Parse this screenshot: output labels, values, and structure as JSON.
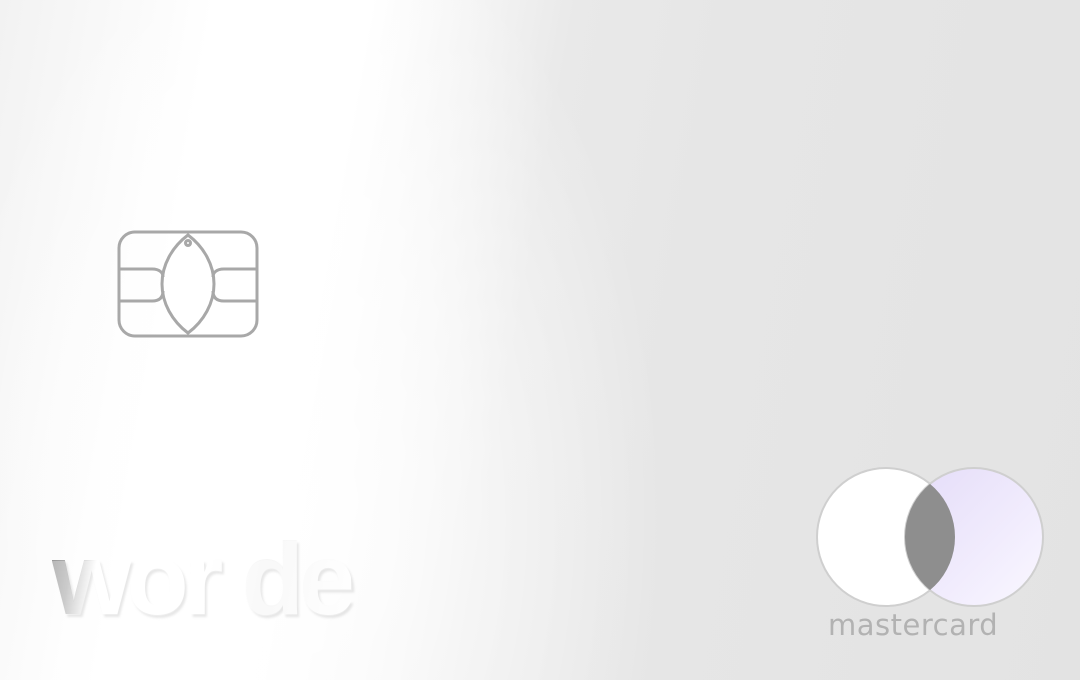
{
  "card": {
    "brand_text": "wor     de",
    "network_text": "mastercard"
  },
  "icons": {
    "chip": "emv-chip-icon",
    "network_logo": "mastercard-circles-icon"
  },
  "colors": {
    "card_base": "#e6e6e6",
    "highlight": "#ffffff",
    "chip_outline": "#a8a8a8",
    "mc_overlap": "#8e8e8e",
    "mc_right_tint": "#ece6fb",
    "network_text": "#b2b2b2"
  }
}
